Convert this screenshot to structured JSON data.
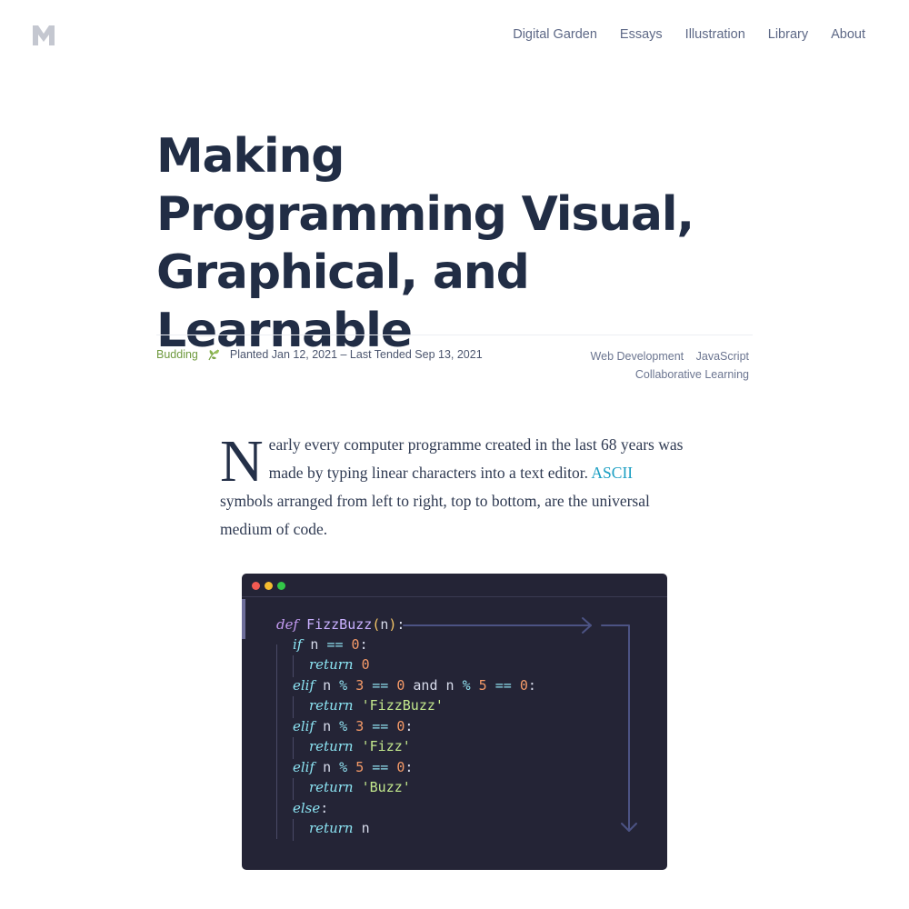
{
  "logo": {
    "icon": "m-logo-icon",
    "color": "#c4c7d0"
  },
  "nav": {
    "items": [
      "Digital Garden",
      "Essays",
      "Illustration",
      "Library",
      "About"
    ]
  },
  "article": {
    "title": "Making Programming Visual, Graphical, and Learnable",
    "stage": "Budding",
    "stage_icon": "sprout-leaf-icon",
    "dates": "Planted Jan 12, 2021 – Last Tended Sep 13, 2021",
    "tags": [
      "Web Development",
      "JavaScript",
      "Collaborative Learning"
    ],
    "dropcap": "N",
    "para_before_link": "early every computer programme created in the last 68 years was made by typing linear characters into a text editor. ",
    "link_text": "ASCII",
    "para_after_link": " symbols arranged from left to right, top to bottom, are the universal medium of code."
  },
  "code": {
    "window_controls": [
      "close",
      "minimize",
      "maximize"
    ],
    "lines": [
      "def FizzBuzz(n):",
      "if n == 0:",
      "return 0",
      "elif n % 3 == 0 and n % 5 == 0:",
      "return 'FizzBuzz'",
      "elif n % 3 == 0:",
      "return 'Fizz'",
      "elif n % 5 == 0:",
      "return 'Buzz'",
      "else:",
      "return n"
    ]
  },
  "colors": {
    "accent_link": "#1a9ec2",
    "stage_green": "#6f9a3f",
    "code_bg": "#242436"
  }
}
